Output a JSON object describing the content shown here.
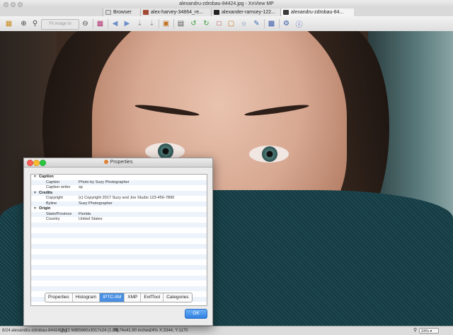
{
  "window": {
    "title": "alexandru-zdrobau-84424.jpg - XnView MP"
  },
  "tabs": [
    {
      "label": "Browser",
      "icon": "browser-icon"
    },
    {
      "label": "alex-harvey-34864_re...",
      "icon": "image-thumbnail-icon"
    },
    {
      "label": "alexander-ramsey-122...",
      "icon": "image-thumbnail-icon"
    },
    {
      "label": "alexandru-zdrobau-84...",
      "icon": "image-thumbnail-icon"
    }
  ],
  "toolbar": {
    "fit_label": "Fit image to window",
    "icons": [
      "browse-icon",
      "zoom-in-icon",
      "zoom-search-icon",
      "zoom-out-icon",
      "grid-icon",
      "arrow-left-icon",
      "arrow-right-icon",
      "down-icon",
      "down-alt-icon",
      "slideshow-icon",
      "fullscreen-icon",
      "rotate-left-icon",
      "rotate-right-icon",
      "crop-icon",
      "resize-icon",
      "adjust-icon",
      "edit-icon",
      "settings-icon",
      "info-icon"
    ]
  },
  "dialog": {
    "title": "Properties",
    "tree": [
      {
        "type": "section",
        "label": "Caption"
      },
      {
        "type": "item",
        "key": "Caption",
        "value": "Photo by Suzy Photographer"
      },
      {
        "type": "item",
        "key": "Caption writer",
        "value": "sp"
      },
      {
        "type": "section",
        "label": "Credits"
      },
      {
        "type": "item",
        "key": "Copyright",
        "value": "(c) Copyright 2017 Suzy and Joe Studio  123-456-7890"
      },
      {
        "type": "item",
        "key": "Byline",
        "value": "Suzy Photographer"
      },
      {
        "type": "section",
        "label": "Origin"
      },
      {
        "type": "item",
        "key": "State/Province",
        "value": "Florida"
      },
      {
        "type": "item",
        "key": "Country",
        "value": "United States"
      }
    ],
    "tabs": [
      "Properties",
      "Histogram",
      "IPTC-IIM",
      "XMP",
      "ExifTool",
      "Categories"
    ],
    "selected_tab": "IPTC-IIM",
    "ok_label": "OK"
  },
  "statusbar": {
    "index": "8/24",
    "filename": "alexandru-zdrobau-84424.jpg",
    "filesize": "12.22 MiB",
    "dimensions": "5660x3017x24 (1.88)",
    "print_size": "78.74x41.90 inches",
    "zoom_info": "24%",
    "coords": "X:3344, Y:1170",
    "zoom_select": "24%"
  },
  "colors": {
    "accent": "#4a90e2",
    "scarf": "#1d4850"
  }
}
